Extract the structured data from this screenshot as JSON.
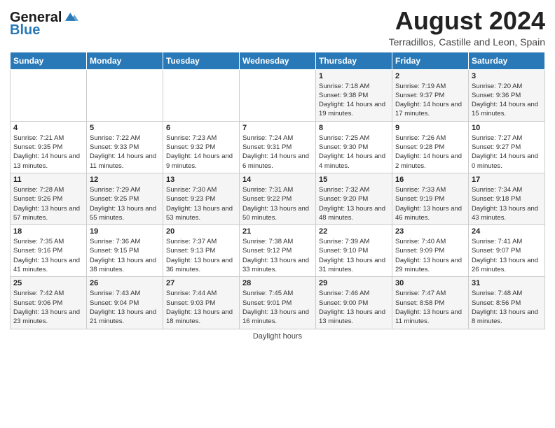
{
  "logo": {
    "line1": "General",
    "line2": "Blue"
  },
  "title": {
    "month_year": "August 2024",
    "location": "Terradillos, Castille and Leon, Spain"
  },
  "days_of_week": [
    "Sunday",
    "Monday",
    "Tuesday",
    "Wednesday",
    "Thursday",
    "Friday",
    "Saturday"
  ],
  "weeks": [
    [
      {
        "day": "",
        "info": ""
      },
      {
        "day": "",
        "info": ""
      },
      {
        "day": "",
        "info": ""
      },
      {
        "day": "",
        "info": ""
      },
      {
        "day": "1",
        "info": "Sunrise: 7:18 AM\nSunset: 9:38 PM\nDaylight: 14 hours and 19 minutes."
      },
      {
        "day": "2",
        "info": "Sunrise: 7:19 AM\nSunset: 9:37 PM\nDaylight: 14 hours and 17 minutes."
      },
      {
        "day": "3",
        "info": "Sunrise: 7:20 AM\nSunset: 9:36 PM\nDaylight: 14 hours and 15 minutes."
      }
    ],
    [
      {
        "day": "4",
        "info": "Sunrise: 7:21 AM\nSunset: 9:35 PM\nDaylight: 14 hours and 13 minutes."
      },
      {
        "day": "5",
        "info": "Sunrise: 7:22 AM\nSunset: 9:33 PM\nDaylight: 14 hours and 11 minutes."
      },
      {
        "day": "6",
        "info": "Sunrise: 7:23 AM\nSunset: 9:32 PM\nDaylight: 14 hours and 9 minutes."
      },
      {
        "day": "7",
        "info": "Sunrise: 7:24 AM\nSunset: 9:31 PM\nDaylight: 14 hours and 6 minutes."
      },
      {
        "day": "8",
        "info": "Sunrise: 7:25 AM\nSunset: 9:30 PM\nDaylight: 14 hours and 4 minutes."
      },
      {
        "day": "9",
        "info": "Sunrise: 7:26 AM\nSunset: 9:28 PM\nDaylight: 14 hours and 2 minutes."
      },
      {
        "day": "10",
        "info": "Sunrise: 7:27 AM\nSunset: 9:27 PM\nDaylight: 14 hours and 0 minutes."
      }
    ],
    [
      {
        "day": "11",
        "info": "Sunrise: 7:28 AM\nSunset: 9:26 PM\nDaylight: 13 hours and 57 minutes."
      },
      {
        "day": "12",
        "info": "Sunrise: 7:29 AM\nSunset: 9:25 PM\nDaylight: 13 hours and 55 minutes."
      },
      {
        "day": "13",
        "info": "Sunrise: 7:30 AM\nSunset: 9:23 PM\nDaylight: 13 hours and 53 minutes."
      },
      {
        "day": "14",
        "info": "Sunrise: 7:31 AM\nSunset: 9:22 PM\nDaylight: 13 hours and 50 minutes."
      },
      {
        "day": "15",
        "info": "Sunrise: 7:32 AM\nSunset: 9:20 PM\nDaylight: 13 hours and 48 minutes."
      },
      {
        "day": "16",
        "info": "Sunrise: 7:33 AM\nSunset: 9:19 PM\nDaylight: 13 hours and 46 minutes."
      },
      {
        "day": "17",
        "info": "Sunrise: 7:34 AM\nSunset: 9:18 PM\nDaylight: 13 hours and 43 minutes."
      }
    ],
    [
      {
        "day": "18",
        "info": "Sunrise: 7:35 AM\nSunset: 9:16 PM\nDaylight: 13 hours and 41 minutes."
      },
      {
        "day": "19",
        "info": "Sunrise: 7:36 AM\nSunset: 9:15 PM\nDaylight: 13 hours and 38 minutes."
      },
      {
        "day": "20",
        "info": "Sunrise: 7:37 AM\nSunset: 9:13 PM\nDaylight: 13 hours and 36 minutes."
      },
      {
        "day": "21",
        "info": "Sunrise: 7:38 AM\nSunset: 9:12 PM\nDaylight: 13 hours and 33 minutes."
      },
      {
        "day": "22",
        "info": "Sunrise: 7:39 AM\nSunset: 9:10 PM\nDaylight: 13 hours and 31 minutes."
      },
      {
        "day": "23",
        "info": "Sunrise: 7:40 AM\nSunset: 9:09 PM\nDaylight: 13 hours and 29 minutes."
      },
      {
        "day": "24",
        "info": "Sunrise: 7:41 AM\nSunset: 9:07 PM\nDaylight: 13 hours and 26 minutes."
      }
    ],
    [
      {
        "day": "25",
        "info": "Sunrise: 7:42 AM\nSunset: 9:06 PM\nDaylight: 13 hours and 23 minutes."
      },
      {
        "day": "26",
        "info": "Sunrise: 7:43 AM\nSunset: 9:04 PM\nDaylight: 13 hours and 21 minutes."
      },
      {
        "day": "27",
        "info": "Sunrise: 7:44 AM\nSunset: 9:03 PM\nDaylight: 13 hours and 18 minutes."
      },
      {
        "day": "28",
        "info": "Sunrise: 7:45 AM\nSunset: 9:01 PM\nDaylight: 13 hours and 16 minutes."
      },
      {
        "day": "29",
        "info": "Sunrise: 7:46 AM\nSunset: 9:00 PM\nDaylight: 13 hours and 13 minutes."
      },
      {
        "day": "30",
        "info": "Sunrise: 7:47 AM\nSunset: 8:58 PM\nDaylight: 13 hours and 11 minutes."
      },
      {
        "day": "31",
        "info": "Sunrise: 7:48 AM\nSunset: 8:56 PM\nDaylight: 13 hours and 8 minutes."
      }
    ]
  ],
  "footer": {
    "daylight_label": "Daylight hours"
  }
}
